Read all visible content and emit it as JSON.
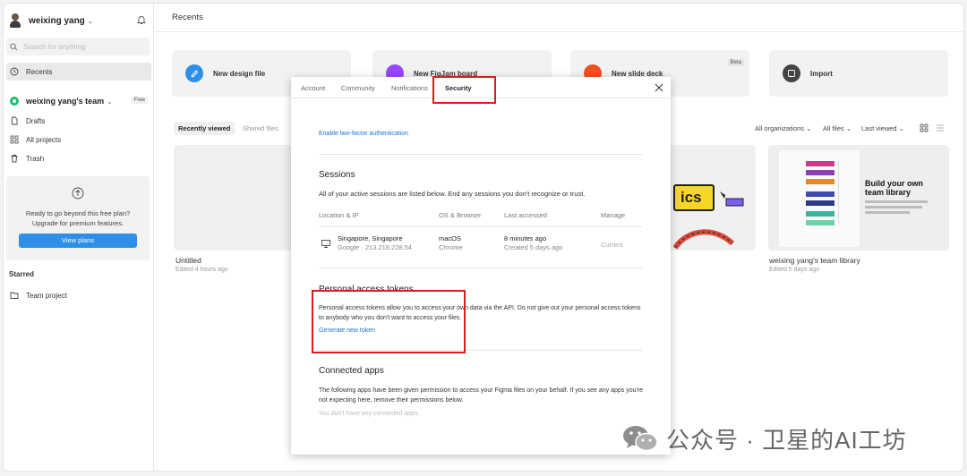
{
  "sidebar": {
    "user_name": "weixing yang",
    "search_placeholder": "Search for anything",
    "recents_label": "Recents",
    "team_name": "weixing yang's team",
    "team_badge": "Free",
    "nav": {
      "drafts": "Drafts",
      "all_projects": "All projects",
      "trash": "Trash"
    },
    "upgrade": {
      "line1": "Ready to go beyond this free plan?",
      "line2": "Upgrade for premium features.",
      "button": "View plans"
    },
    "starred_label": "Starred",
    "team_project": "Team project"
  },
  "main": {
    "title": "Recents",
    "cards": {
      "design": "New design file",
      "figjam": "New FigJam board",
      "slides": "New slide deck",
      "slides_badge": "Beta",
      "import": "Import"
    },
    "filters": {
      "recently_viewed": "Recently viewed",
      "shared_files": "Shared files",
      "all_orgs": "All organizations",
      "all_files": "All files",
      "last_viewed": "Last viewed"
    },
    "files": [
      {
        "name": "Untitled",
        "meta": "Edited 4 hours ago"
      },
      {
        "name": "weixing yang's team library",
        "meta": "Edited 5 days ago"
      }
    ],
    "library_thumb": {
      "heading": "Build your own team library",
      "fragment": "ics"
    }
  },
  "modal": {
    "tabs": [
      "Account",
      "Community",
      "Notifications",
      "Security"
    ],
    "two_factor_link": "Enable two-factor authentication",
    "sessions": {
      "title": "Sessions",
      "description": "All of your active sessions are listed below. End any sessions you don't recognize or trust.",
      "columns": [
        "Location & IP",
        "OS & Browser",
        "Last accessed",
        "Manage"
      ],
      "rows": [
        {
          "location": "Singapore, Singapore",
          "ip": "Google · 213.218.228.54",
          "os": "macOS",
          "browser": "Chrome",
          "last_accessed": "8 minutes ago",
          "created": "Created 5 days ago",
          "manage": "Current"
        }
      ]
    },
    "tokens": {
      "title": "Personal access tokens",
      "description": "Personal access tokens allow you to access your own data via the API. Do not give out your personal access tokens to anybody who you don't want to access your files.",
      "link": "Generate new token"
    },
    "connected_apps": {
      "title": "Connected apps",
      "description": "The following apps have been given permission to access your Figma files on your behalf. If you see any apps you're not expecting here, remove their permissions below.",
      "empty": "You don't have any connected apps."
    }
  },
  "watermark": "公众号 · 卫星的AI工坊",
  "colors": {
    "accent": "#2d8fe8",
    "link": "#1a73d9",
    "annotation_red": "#e0191a",
    "team_green": "#1bbf6e"
  }
}
